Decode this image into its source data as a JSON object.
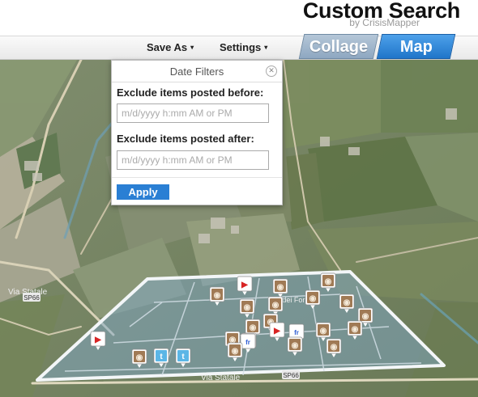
{
  "header": {
    "title": "Custom Search",
    "subtitle": "by CrisisMapper"
  },
  "toolbar": {
    "save_as_label": "Save As",
    "settings_label": "Settings",
    "caret": "▾"
  },
  "view_tabs": [
    {
      "label": "Collage",
      "active": false
    },
    {
      "label": "Map",
      "active": true
    }
  ],
  "date_filters": {
    "title": "Date Filters",
    "close_glyph": "✕",
    "before_label": "Exclude items posted before:",
    "before_placeholder": "m/d/yyyy h:mm AM or PM",
    "after_label": "Exclude items posted after:",
    "after_placeholder": "m/d/yyyy h:mm AM or PM",
    "apply_label": "Apply"
  },
  "map": {
    "road_labels": [
      "SP66",
      "Via Statale",
      "SP66",
      "Via dei Fornai",
      "Via Statale"
    ],
    "marker_icons": [
      "youtube-marker-icon",
      "instagram-marker-icon",
      "instagram-marker-icon",
      "instagram-marker-icon",
      "instagram-marker-icon",
      "instagram-marker-icon",
      "instagram-marker-icon",
      "instagram-marker-icon",
      "instagram-marker-icon",
      "instagram-marker-icon",
      "instagram-marker-icon",
      "instagram-marker-icon",
      "instagram-marker-icon",
      "instagram-marker-icon",
      "flickr-marker-icon",
      "youtube-marker-icon",
      "flickr-marker-icon",
      "instagram-marker-icon",
      "instagram-marker-icon",
      "instagram-marker-icon",
      "youtube-marker-icon",
      "instagram-marker-icon",
      "twitter-marker-icon",
      "twitter-marker-icon",
      "instagram-marker-icon"
    ]
  },
  "colors": {
    "accent": "#2a7fd4",
    "map_tab": "#2f86d8",
    "collage_tab": "#9fb4ca",
    "search_area": "#7fa8c8"
  }
}
